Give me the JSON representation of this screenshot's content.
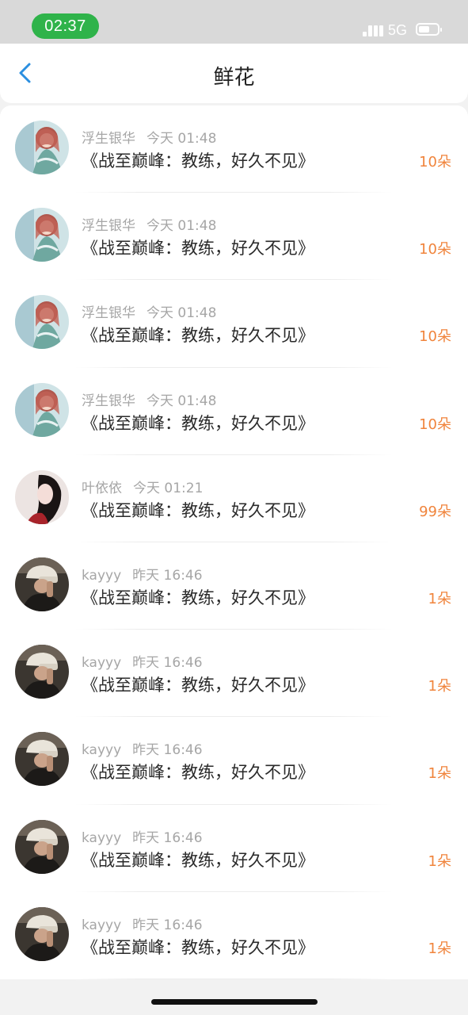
{
  "status_bar": {
    "time": "02:37",
    "network": "5G",
    "battery_level": 0.6,
    "signal_icon": "signal-bars-icon",
    "battery_icon": "battery-icon"
  },
  "nav": {
    "title": "鲜花",
    "back_icon": "chevron-left-icon",
    "accent_color": "#2b8fe0"
  },
  "colors": {
    "amount": "#f0843c",
    "time_pill": "#2fb34a"
  },
  "items": [
    {
      "user": "浮生银华",
      "time": "今天 01:48",
      "title": "《战至巅峰：教练，好久不见》",
      "amount": "10朵",
      "avatar": "anime-girl-avatar"
    },
    {
      "user": "浮生银华",
      "time": "今天 01:48",
      "title": "《战至巅峰：教练，好久不见》",
      "amount": "10朵",
      "avatar": "anime-girl-avatar"
    },
    {
      "user": "浮生银华",
      "time": "今天 01:48",
      "title": "《战至巅峰：教练，好久不见》",
      "amount": "10朵",
      "avatar": "anime-girl-avatar"
    },
    {
      "user": "浮生银华",
      "time": "今天 01:48",
      "title": "《战至巅峰：教练，好久不见》",
      "amount": "10朵",
      "avatar": "anime-girl-avatar"
    },
    {
      "user": "叶依依",
      "time": "今天 01:21",
      "title": "《战至巅峰：教练，好久不见》",
      "amount": "99朵",
      "avatar": "portrait-avatar"
    },
    {
      "user": "kayyy",
      "time": "昨天 16:46",
      "title": "《战至巅峰：教练，好久不见》",
      "amount": "1朵",
      "avatar": "cap-person-avatar"
    },
    {
      "user": "kayyy",
      "time": "昨天 16:46",
      "title": "《战至巅峰：教练，好久不见》",
      "amount": "1朵",
      "avatar": "cap-person-avatar"
    },
    {
      "user": "kayyy",
      "time": "昨天 16:46",
      "title": "《战至巅峰：教练，好久不见》",
      "amount": "1朵",
      "avatar": "cap-person-avatar"
    },
    {
      "user": "kayyy",
      "time": "昨天 16:46",
      "title": "《战至巅峰：教练，好久不见》",
      "amount": "1朵",
      "avatar": "cap-person-avatar"
    },
    {
      "user": "kayyy",
      "time": "昨天 16:46",
      "title": "《战至巅峰：教练，好久不见》",
      "amount": "1朵",
      "avatar": "cap-person-avatar"
    }
  ]
}
